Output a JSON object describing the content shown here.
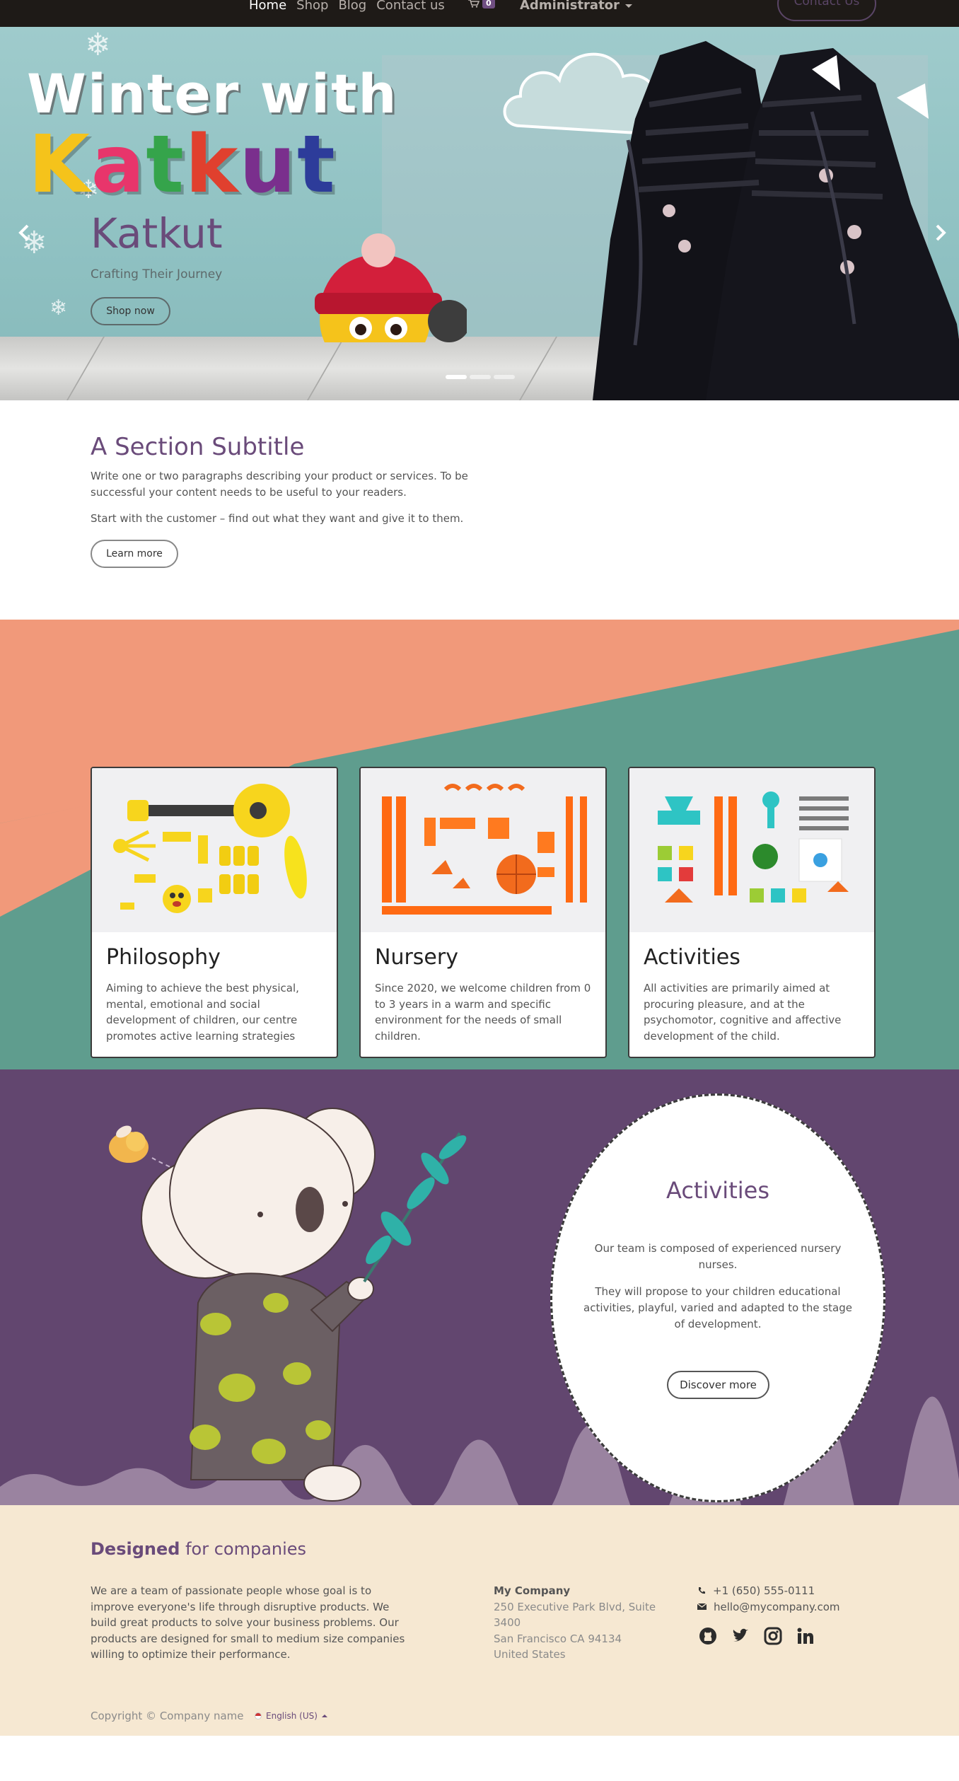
{
  "nav": {
    "links": [
      "Home",
      "Shop",
      "Blog",
      "Contact us"
    ],
    "cart_count": "0",
    "user": "Administrator",
    "contact_button": "Contact Us"
  },
  "hero": {
    "banner_line1": "Winter with",
    "banner_line2": "Katkut",
    "title": "Katkut",
    "subtitle": "Crafting Their Journey",
    "button": "Shop now",
    "slides": 3,
    "active_slide": 1
  },
  "intro": {
    "title": "A Section Subtitle",
    "paragraph1": "Write one or two paragraphs describing your product or services. To be successful your content needs to be useful to your readers.",
    "paragraph2": "Start with the customer – find out what they want and give it to them.",
    "button": "Learn more"
  },
  "cards": [
    {
      "title": "Philosophy",
      "text": "Aiming to achieve the best physical, mental, emotional and social development of children, our centre promotes active learning strategies"
    },
    {
      "title": "Nursery",
      "text": "Since 2020, we welcome children from 0 to 3 years in a warm and specific environment for the needs of small children."
    },
    {
      "title": "Activities",
      "text": "All activities are primarily aimed at procuring pleasure, and at the psychomotor, cognitive and affective development of the child."
    }
  ],
  "activities": {
    "title": "Activities",
    "paragraph1": "Our team is composed of experienced nursery nurses.",
    "paragraph2": "They will propose to your children educational activities, playful, varied and adapted to the stage of development.",
    "button": "Discover more"
  },
  "footer": {
    "heading_bold": "Designed",
    "heading_rest": " for companies",
    "about": "We are a team of passionate people whose goal is to improve everyone's life through disruptive products. We build great products to solve your business problems. Our products are designed for small to medium size companies willing to optimize their performance.",
    "company_name": "My Company",
    "address1": "250 Executive Park Blvd, Suite 3400",
    "address2": "San Francisco CA 94134",
    "address3": "United States",
    "phone": "+1 (650) 555-0111",
    "email": "hello@mycompany.com",
    "social_icons": [
      "github-icon",
      "twitter-icon",
      "instagram-icon",
      "linkedin-icon"
    ],
    "copyright": "Copyright © Company name",
    "language": "English (US)"
  },
  "colors": {
    "brand_purple": "#6a4b7a",
    "section_purple": "#62466f",
    "salmon": "#f1997a",
    "teal": "#5f9d8e",
    "footer_bg": "#f6e8d2",
    "navbar_bg": "#1e1a17"
  }
}
